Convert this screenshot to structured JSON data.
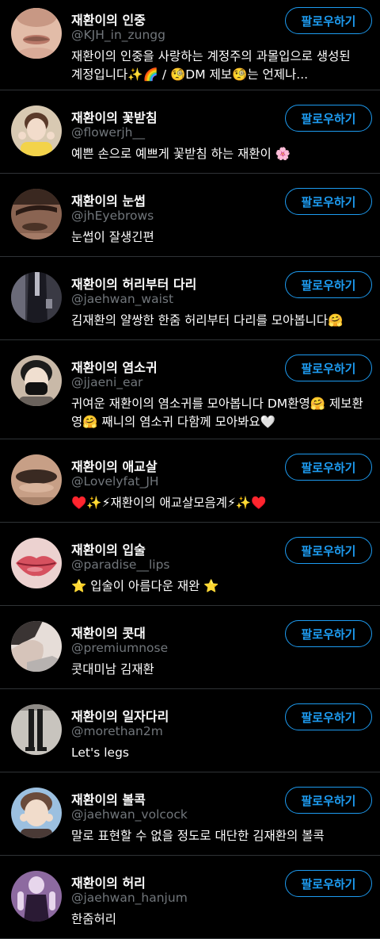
{
  "follow_label": "팔로우하기",
  "accounts": [
    {
      "name": "재환이의 인중",
      "handle": "@KJH_in_zungg",
      "bio": "재환이의 인중을 사랑하는 계정주의 과몰입으로 생성된 계정입니다✨🌈 / 🧐DM 제보🧐는 언제나...",
      "avatar_icon": "lips-face-avatar",
      "avatar_colors": [
        "#c89884",
        "#e9c7b5",
        "#8a5a4c"
      ]
    },
    {
      "name": "재환이의 꽃받침",
      "handle": "@flowerjh__",
      "bio": "예쁜 손으로 예쁘게 꽃받침 하는 재환이 🌸",
      "avatar_icon": "person-avatar",
      "avatar_colors": [
        "#d8c9b2",
        "#f2dccb",
        "#f3d34a"
      ]
    },
    {
      "name": "재환이의 눈썹",
      "handle": "@jhEyebrows",
      "bio": "눈썹이 잘생긴편",
      "avatar_icon": "eyebrow-avatar",
      "avatar_colors": [
        "#6b4a3a",
        "#2a1a14",
        "#a37a66"
      ]
    },
    {
      "name": "재환이의 허리부터 다리",
      "handle": "@jaehwan_waist",
      "bio": "김재환의 얄쌍한 한줌 허리부터 다리를 모아봅니다🤗",
      "avatar_icon": "waist-avatar",
      "avatar_colors": [
        "#5a5a66",
        "#1a1a22",
        "#b9b9c4"
      ]
    },
    {
      "name": "재환이의 염소귀",
      "handle": "@jjaeni_ear",
      "bio": "귀여운 재환이의 염소귀를 모아봅니다 DM환영🤗 제보환영🤗 째니의 염소귀 다함께 모아봐요🤍",
      "avatar_icon": "masked-person-avatar",
      "avatar_colors": [
        "#c9b9a8",
        "#f0dfd0",
        "#111111"
      ]
    },
    {
      "name": "재환이의 애교살",
      "handle": "@Lovelyfat_JH",
      "bio": "♥️✨⚡재환이의 애교살모음계⚡✨♥️",
      "avatar_icon": "eye-avatar",
      "avatar_colors": [
        "#a8826a",
        "#d9b49c",
        "#3a2a22"
      ]
    },
    {
      "name": "재환이의 입술",
      "handle": "@paradise__lips",
      "bio": "⭐ 입술이 아름다운 재완 ⭐",
      "avatar_icon": "lips-avatar",
      "avatar_colors": [
        "#e9c7c7",
        "#d6515f",
        "#b83446"
      ]
    },
    {
      "name": "재환이의 콧대",
      "handle": "@premiumnose",
      "bio": "콧대미남 김재환",
      "avatar_icon": "profile-avatar",
      "avatar_colors": [
        "#b7b2b0",
        "#e6ddd8",
        "#3a3433"
      ]
    },
    {
      "name": "재환이의 일자다리",
      "handle": "@morethan2m",
      "bio": "Let's legs",
      "avatar_icon": "legs-avatar",
      "avatar_colors": [
        "#c8c4be",
        "#1a1a1a",
        "#8e8a86"
      ]
    },
    {
      "name": "재환이의 볼콕",
      "handle": "@jaehwan_volcock",
      "bio": "말로 표현할 수 없을 정도로 대단한 김재환의 볼콕",
      "avatar_icon": "cheek-poke-avatar",
      "avatar_colors": [
        "#9cc0e0",
        "#f1dccb",
        "#4a3a36"
      ]
    },
    {
      "name": "재환이의 허리",
      "handle": "@jaehwan_hanjum",
      "bio": "한줌허리",
      "avatar_icon": "stage-avatar",
      "avatar_colors": [
        "#8d6aa0",
        "#e7d6ec",
        "#2a1a34"
      ]
    }
  ]
}
